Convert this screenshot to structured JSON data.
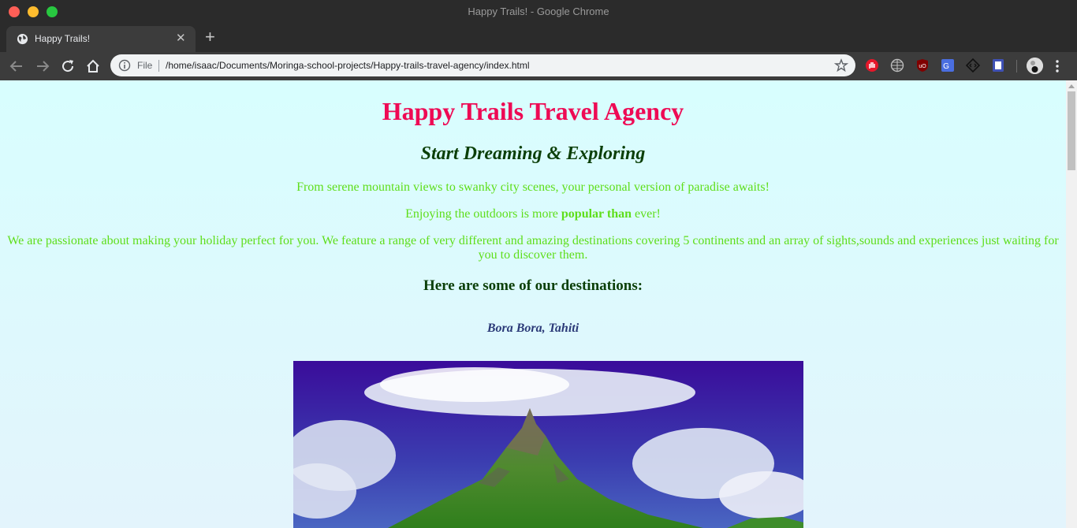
{
  "window": {
    "title": "Happy Trails! - Google Chrome"
  },
  "tab": {
    "title": "Happy Trails!",
    "favicon": "globe-icon"
  },
  "toolbar": {
    "scheme_label": "File",
    "url": "/home/isaac/Documents/Moringa-school-projects/Happy-trails-travel-agency/index.html",
    "extensions": [
      "hand-stop-icon",
      "globe-extension-icon",
      "ublock-icon",
      "translate-icon",
      "code-diamond-icon",
      "book-icon"
    ]
  },
  "page": {
    "title": "Happy Trails Travel Agency",
    "subtitle": "Start Dreaming & Exploring",
    "paragraph1": "From serene mountain views to swanky city scenes, your personal version of paradise awaits!",
    "paragraph2_pre": "Enjoying the outdoors is more ",
    "paragraph2_bold": "popular than",
    "paragraph2_post": " ever!",
    "paragraph3": "We are passionate about making your holiday perfect for you. We feature a range of very different and amazing destinations covering 5 continents and an array of sights,sounds and experiences just waiting for you to discover them.",
    "destinations_heading": "Here are some of our destinations:",
    "destination1": "Bora Bora, Tahiti"
  },
  "colors": {
    "title": "#ee0a54",
    "subtitle": "#0b3f08",
    "paragraph": "#5ede1a",
    "destination": "#2b3a78",
    "background": "#d8fefe"
  }
}
